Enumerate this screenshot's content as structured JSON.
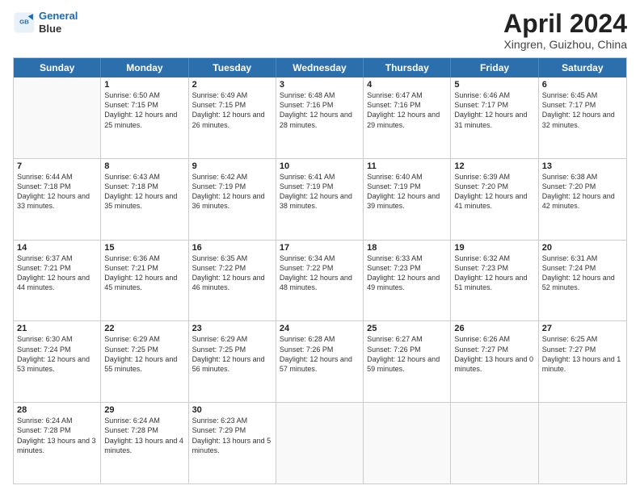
{
  "logo": {
    "line1": "General",
    "line2": "Blue"
  },
  "title": "April 2024",
  "location": "Xingren, Guizhou, China",
  "day_names": [
    "Sunday",
    "Monday",
    "Tuesday",
    "Wednesday",
    "Thursday",
    "Friday",
    "Saturday"
  ],
  "weeks": [
    [
      {
        "day": "",
        "sunrise": "",
        "sunset": "",
        "daylight": ""
      },
      {
        "day": "1",
        "sunrise": "Sunrise: 6:50 AM",
        "sunset": "Sunset: 7:15 PM",
        "daylight": "Daylight: 12 hours and 25 minutes."
      },
      {
        "day": "2",
        "sunrise": "Sunrise: 6:49 AM",
        "sunset": "Sunset: 7:15 PM",
        "daylight": "Daylight: 12 hours and 26 minutes."
      },
      {
        "day": "3",
        "sunrise": "Sunrise: 6:48 AM",
        "sunset": "Sunset: 7:16 PM",
        "daylight": "Daylight: 12 hours and 28 minutes."
      },
      {
        "day": "4",
        "sunrise": "Sunrise: 6:47 AM",
        "sunset": "Sunset: 7:16 PM",
        "daylight": "Daylight: 12 hours and 29 minutes."
      },
      {
        "day": "5",
        "sunrise": "Sunrise: 6:46 AM",
        "sunset": "Sunset: 7:17 PM",
        "daylight": "Daylight: 12 hours and 31 minutes."
      },
      {
        "day": "6",
        "sunrise": "Sunrise: 6:45 AM",
        "sunset": "Sunset: 7:17 PM",
        "daylight": "Daylight: 12 hours and 32 minutes."
      }
    ],
    [
      {
        "day": "7",
        "sunrise": "Sunrise: 6:44 AM",
        "sunset": "Sunset: 7:18 PM",
        "daylight": "Daylight: 12 hours and 33 minutes."
      },
      {
        "day": "8",
        "sunrise": "Sunrise: 6:43 AM",
        "sunset": "Sunset: 7:18 PM",
        "daylight": "Daylight: 12 hours and 35 minutes."
      },
      {
        "day": "9",
        "sunrise": "Sunrise: 6:42 AM",
        "sunset": "Sunset: 7:19 PM",
        "daylight": "Daylight: 12 hours and 36 minutes."
      },
      {
        "day": "10",
        "sunrise": "Sunrise: 6:41 AM",
        "sunset": "Sunset: 7:19 PM",
        "daylight": "Daylight: 12 hours and 38 minutes."
      },
      {
        "day": "11",
        "sunrise": "Sunrise: 6:40 AM",
        "sunset": "Sunset: 7:19 PM",
        "daylight": "Daylight: 12 hours and 39 minutes."
      },
      {
        "day": "12",
        "sunrise": "Sunrise: 6:39 AM",
        "sunset": "Sunset: 7:20 PM",
        "daylight": "Daylight: 12 hours and 41 minutes."
      },
      {
        "day": "13",
        "sunrise": "Sunrise: 6:38 AM",
        "sunset": "Sunset: 7:20 PM",
        "daylight": "Daylight: 12 hours and 42 minutes."
      }
    ],
    [
      {
        "day": "14",
        "sunrise": "Sunrise: 6:37 AM",
        "sunset": "Sunset: 7:21 PM",
        "daylight": "Daylight: 12 hours and 44 minutes."
      },
      {
        "day": "15",
        "sunrise": "Sunrise: 6:36 AM",
        "sunset": "Sunset: 7:21 PM",
        "daylight": "Daylight: 12 hours and 45 minutes."
      },
      {
        "day": "16",
        "sunrise": "Sunrise: 6:35 AM",
        "sunset": "Sunset: 7:22 PM",
        "daylight": "Daylight: 12 hours and 46 minutes."
      },
      {
        "day": "17",
        "sunrise": "Sunrise: 6:34 AM",
        "sunset": "Sunset: 7:22 PM",
        "daylight": "Daylight: 12 hours and 48 minutes."
      },
      {
        "day": "18",
        "sunrise": "Sunrise: 6:33 AM",
        "sunset": "Sunset: 7:23 PM",
        "daylight": "Daylight: 12 hours and 49 minutes."
      },
      {
        "day": "19",
        "sunrise": "Sunrise: 6:32 AM",
        "sunset": "Sunset: 7:23 PM",
        "daylight": "Daylight: 12 hours and 51 minutes."
      },
      {
        "day": "20",
        "sunrise": "Sunrise: 6:31 AM",
        "sunset": "Sunset: 7:24 PM",
        "daylight": "Daylight: 12 hours and 52 minutes."
      }
    ],
    [
      {
        "day": "21",
        "sunrise": "Sunrise: 6:30 AM",
        "sunset": "Sunset: 7:24 PM",
        "daylight": "Daylight: 12 hours and 53 minutes."
      },
      {
        "day": "22",
        "sunrise": "Sunrise: 6:29 AM",
        "sunset": "Sunset: 7:25 PM",
        "daylight": "Daylight: 12 hours and 55 minutes."
      },
      {
        "day": "23",
        "sunrise": "Sunrise: 6:29 AM",
        "sunset": "Sunset: 7:25 PM",
        "daylight": "Daylight: 12 hours and 56 minutes."
      },
      {
        "day": "24",
        "sunrise": "Sunrise: 6:28 AM",
        "sunset": "Sunset: 7:26 PM",
        "daylight": "Daylight: 12 hours and 57 minutes."
      },
      {
        "day": "25",
        "sunrise": "Sunrise: 6:27 AM",
        "sunset": "Sunset: 7:26 PM",
        "daylight": "Daylight: 12 hours and 59 minutes."
      },
      {
        "day": "26",
        "sunrise": "Sunrise: 6:26 AM",
        "sunset": "Sunset: 7:27 PM",
        "daylight": "Daylight: 13 hours and 0 minutes."
      },
      {
        "day": "27",
        "sunrise": "Sunrise: 6:25 AM",
        "sunset": "Sunset: 7:27 PM",
        "daylight": "Daylight: 13 hours and 1 minute."
      }
    ],
    [
      {
        "day": "28",
        "sunrise": "Sunrise: 6:24 AM",
        "sunset": "Sunset: 7:28 PM",
        "daylight": "Daylight: 13 hours and 3 minutes."
      },
      {
        "day": "29",
        "sunrise": "Sunrise: 6:24 AM",
        "sunset": "Sunset: 7:28 PM",
        "daylight": "Daylight: 13 hours and 4 minutes."
      },
      {
        "day": "30",
        "sunrise": "Sunrise: 6:23 AM",
        "sunset": "Sunset: 7:29 PM",
        "daylight": "Daylight: 13 hours and 5 minutes."
      },
      {
        "day": "",
        "sunrise": "",
        "sunset": "",
        "daylight": ""
      },
      {
        "day": "",
        "sunrise": "",
        "sunset": "",
        "daylight": ""
      },
      {
        "day": "",
        "sunrise": "",
        "sunset": "",
        "daylight": ""
      },
      {
        "day": "",
        "sunrise": "",
        "sunset": "",
        "daylight": ""
      }
    ]
  ]
}
